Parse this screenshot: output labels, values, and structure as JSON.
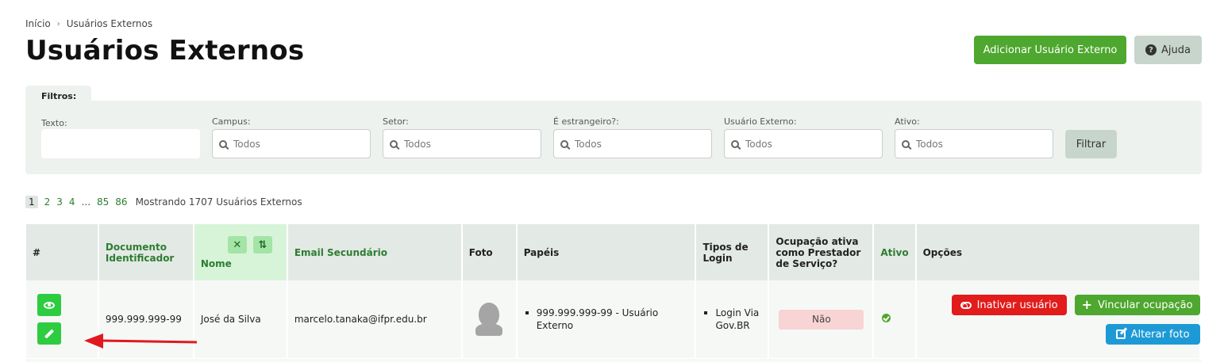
{
  "breadcrumb": {
    "home": "Início",
    "current": "Usuários Externos"
  },
  "page": {
    "title": "Usuários Externos"
  },
  "header_buttons": {
    "add": "Adicionar Usuário Externo",
    "help": "Ajuda"
  },
  "filters": {
    "tab_label": "Filtros:",
    "texto": {
      "label": "Texto:",
      "value": ""
    },
    "campus": {
      "label": "Campus:",
      "value": "Todos"
    },
    "setor": {
      "label": "Setor:",
      "value": "Todos"
    },
    "estrangeiro": {
      "label": "É estrangeiro?:",
      "value": "Todos"
    },
    "usuario_externo": {
      "label": "Usuário Externo:",
      "value": "Todos"
    },
    "ativo": {
      "label": "Ativo:",
      "value": "Todos"
    },
    "submit": "Filtrar"
  },
  "pagination": {
    "current": "1",
    "pages": [
      "2",
      "3",
      "4"
    ],
    "ellipsis": "...",
    "last_pages": [
      "85",
      "86"
    ],
    "info": "Mostrando 1707 Usuários Externos"
  },
  "table": {
    "headers": {
      "index": "#",
      "documento": "Documento Identificador",
      "nome": "Nome",
      "email": "Email Secundário",
      "foto": "Foto",
      "papeis": "Papéis",
      "tipos_login": "Tipos de Login",
      "ocupacao": "Ocupação ativa como Prestador de Serviço?",
      "ativo": "Ativo",
      "opcoes": "Opções"
    },
    "rows": [
      {
        "documento": "999.999.999-99",
        "nome": "José da Silva",
        "email": "marcelo.tanaka@ifpr.edu.br",
        "papeis": [
          "999.999.999-99 - Usuário Externo"
        ],
        "tipos_login": [
          "Login Via Gov.BR"
        ],
        "ocupacao": "Não",
        "ativo": true,
        "actions": {
          "inativar": "Inativar usuário",
          "vincular": "Vincular ocupação",
          "alterar_foto": "Alterar foto"
        }
      }
    ]
  },
  "colors": {
    "primary_green": "#4ea72e",
    "danger_red": "#e21b1b",
    "info_blue": "#1d9ad6",
    "action_green": "#2ecc40",
    "annotation_arrow": "#e0191f"
  },
  "icons": [
    "chevron-right-icon",
    "question-circle-icon",
    "search-icon",
    "close-icon",
    "sort-icon",
    "eye-icon",
    "pencil-icon",
    "avatar-placeholder-icon",
    "check-circle-icon",
    "toggle-icon",
    "plus-icon",
    "edit-icon",
    "arrow-annotation"
  ]
}
